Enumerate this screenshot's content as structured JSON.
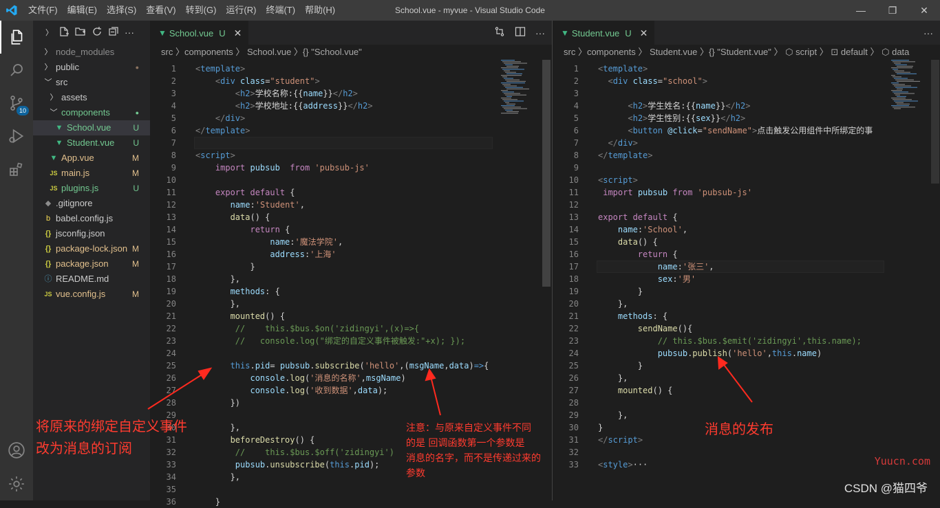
{
  "app": {
    "menu": [
      "文件(F)",
      "编辑(E)",
      "选择(S)",
      "查看(V)",
      "转到(G)",
      "运行(R)",
      "终端(T)",
      "帮助(H)"
    ],
    "window_title": "School.vue - myvue - Visual Studio Code",
    "window_controls": [
      "—",
      "❐",
      "✕"
    ]
  },
  "activity_bar": {
    "icons": [
      "files-icon",
      "search-icon",
      "source-control-icon",
      "run-debug-icon",
      "extensions-icon",
      "account-icon",
      "settings-gear-icon"
    ],
    "scm_badge": "10"
  },
  "explorer": {
    "items": [
      {
        "label": "node_modules",
        "indent": 1,
        "type": "folder-collapsed",
        "color": "#8c8c8c",
        "badge": ""
      },
      {
        "label": "public",
        "indent": 1,
        "type": "folder-collapsed",
        "color": "#cccccc",
        "badge": "●",
        "badge_color": "#8b7360"
      },
      {
        "label": "src",
        "indent": 1,
        "type": "folder-open",
        "color": "#cccccc",
        "badge": ""
      },
      {
        "label": "assets",
        "indent": 2,
        "type": "folder-collapsed",
        "color": "#cccccc",
        "badge": ""
      },
      {
        "label": "components",
        "indent": 2,
        "type": "folder-open",
        "color": "#73c991",
        "badge": "●",
        "badge_color": "#73c991"
      },
      {
        "label": "School.vue",
        "indent": 3,
        "type": "vue",
        "color": "#73c991",
        "badge": "U",
        "badge_color": "#73c991",
        "selected": true
      },
      {
        "label": "Student.vue",
        "indent": 3,
        "type": "vue",
        "color": "#73c991",
        "badge": "U",
        "badge_color": "#73c991"
      },
      {
        "label": "App.vue",
        "indent": 2,
        "type": "vue",
        "color": "#e2c08d",
        "badge": "M",
        "badge_color": "#e2c08d"
      },
      {
        "label": "main.js",
        "indent": 2,
        "type": "js",
        "color": "#e2c08d",
        "badge": "M",
        "badge_color": "#e2c08d"
      },
      {
        "label": "plugins.js",
        "indent": 2,
        "type": "js",
        "color": "#73c991",
        "badge": "U",
        "badge_color": "#73c991"
      },
      {
        "label": ".gitignore",
        "indent": 1,
        "type": "git",
        "color": "#cccccc",
        "badge": ""
      },
      {
        "label": "babel.config.js",
        "indent": 1,
        "type": "babel",
        "color": "#cccccc",
        "badge": ""
      },
      {
        "label": "jsconfig.json",
        "indent": 1,
        "type": "json",
        "color": "#cccccc",
        "badge": ""
      },
      {
        "label": "package-lock.json",
        "indent": 1,
        "type": "json",
        "color": "#e2c08d",
        "badge": "M",
        "badge_color": "#e2c08d"
      },
      {
        "label": "package.json",
        "indent": 1,
        "type": "json",
        "color": "#e2c08d",
        "badge": "M",
        "badge_color": "#e2c08d"
      },
      {
        "label": "README.md",
        "indent": 1,
        "type": "info",
        "color": "#cccccc",
        "badge": ""
      },
      {
        "label": "vue.config.js",
        "indent": 1,
        "type": "js",
        "color": "#e2c08d",
        "badge": "M",
        "badge_color": "#e2c08d"
      }
    ]
  },
  "left_editor": {
    "tab_label": "School.vue",
    "tab_status": "U",
    "breadcrumb": "src 〉components 〉 School.vue 〉{} \"School.vue\"",
    "start_line": 1,
    "lines": [
      [
        [
          "<",
          "t"
        ],
        [
          "template",
          "tg"
        ],
        [
          ">",
          "t"
        ]
      ],
      [
        [
          "    ",
          "pl"
        ],
        [
          "<",
          "t"
        ],
        [
          "div",
          "tg"
        ],
        [
          " class",
          "at"
        ],
        [
          "=",
          "pl"
        ],
        [
          "\"student\"",
          "st"
        ],
        [
          ">",
          "t"
        ]
      ],
      [
        [
          "        ",
          "pl"
        ],
        [
          "<",
          "t"
        ],
        [
          "h2",
          "tg"
        ],
        [
          ">",
          "t"
        ],
        [
          "学校名称:{{",
          "pl"
        ],
        [
          "name",
          "vr"
        ],
        [
          "}}",
          "pl"
        ],
        [
          "</",
          "t"
        ],
        [
          "h2",
          "tg"
        ],
        [
          ">",
          "t"
        ]
      ],
      [
        [
          "        ",
          "pl"
        ],
        [
          "<",
          "t"
        ],
        [
          "h2",
          "tg"
        ],
        [
          ">",
          "t"
        ],
        [
          "学校地址:{{",
          "pl"
        ],
        [
          "address",
          "vr"
        ],
        [
          "}}",
          "pl"
        ],
        [
          "</",
          "t"
        ],
        [
          "h2",
          "tg"
        ],
        [
          ">",
          "t"
        ]
      ],
      [
        [
          "    ",
          "pl"
        ],
        [
          "</",
          "t"
        ],
        [
          "div",
          "tg"
        ],
        [
          ">",
          "t"
        ]
      ],
      [
        [
          "</",
          "t"
        ],
        [
          "template",
          "tg"
        ],
        [
          ">",
          "t"
        ]
      ],
      [
        [
          "",
          "pl"
        ]
      ],
      [
        [
          "<",
          "t"
        ],
        [
          "script",
          "tg"
        ],
        [
          ">",
          "t"
        ]
      ],
      [
        [
          "    ",
          "pl"
        ],
        [
          "import ",
          "kw"
        ],
        [
          "pubsub  ",
          "vr"
        ],
        [
          "from ",
          "kw"
        ],
        [
          "'pubsub-js'",
          "st"
        ]
      ],
      [
        [
          "",
          "pl"
        ]
      ],
      [
        [
          "    ",
          "pl"
        ],
        [
          "export default ",
          "kw"
        ],
        [
          "{",
          "pl"
        ]
      ],
      [
        [
          "       ",
          "pl"
        ],
        [
          "name",
          "vr"
        ],
        [
          ":",
          "pl"
        ],
        [
          "'Student'",
          "st"
        ],
        [
          ",",
          "pl"
        ]
      ],
      [
        [
          "       ",
          "pl"
        ],
        [
          "data",
          "fn"
        ],
        [
          "() {",
          "pl"
        ]
      ],
      [
        [
          "           ",
          "pl"
        ],
        [
          "return ",
          "kw"
        ],
        [
          "{",
          "pl"
        ]
      ],
      [
        [
          "               ",
          "pl"
        ],
        [
          "name",
          "vr"
        ],
        [
          ":",
          "pl"
        ],
        [
          "'魔法学院'",
          "st"
        ],
        [
          ",",
          "pl"
        ]
      ],
      [
        [
          "               ",
          "pl"
        ],
        [
          "address",
          "vr"
        ],
        [
          ":",
          "pl"
        ],
        [
          "'上海'",
          "st"
        ]
      ],
      [
        [
          "           ",
          "pl"
        ],
        [
          "}",
          "pl"
        ]
      ],
      [
        [
          "       ",
          "pl"
        ],
        [
          "},",
          "pl"
        ]
      ],
      [
        [
          "       ",
          "pl"
        ],
        [
          "methods",
          "vr"
        ],
        [
          ": {",
          "pl"
        ]
      ],
      [
        [
          "       ",
          "pl"
        ],
        [
          "},",
          "pl"
        ]
      ],
      [
        [
          "       ",
          "pl"
        ],
        [
          "mounted",
          "fn"
        ],
        [
          "() {",
          "pl"
        ]
      ],
      [
        [
          "        ",
          "pl"
        ],
        [
          "//    this.$bus.$on('zidingyi',(x)=>{",
          "cm"
        ]
      ],
      [
        [
          "        ",
          "pl"
        ],
        [
          "//   console.log(\"绑定的自定义事件被触发:\"+x); });",
          "cm"
        ]
      ],
      [
        [
          "",
          "pl"
        ]
      ],
      [
        [
          "       ",
          "pl"
        ],
        [
          "this",
          "bl"
        ],
        [
          ".",
          "pl"
        ],
        [
          "pid",
          "vr"
        ],
        [
          "= ",
          "pl"
        ],
        [
          "pubsub",
          "vr"
        ],
        [
          ".",
          "pl"
        ],
        [
          "subscribe",
          "fn"
        ],
        [
          "(",
          "pl"
        ],
        [
          "'hello'",
          "st"
        ],
        [
          ",(",
          "pl"
        ],
        [
          "msgName",
          "vr"
        ],
        [
          ",",
          "pl"
        ],
        [
          "data",
          "vr"
        ],
        [
          ")",
          "pl"
        ],
        [
          "=>",
          "bl"
        ],
        [
          "{",
          "pl"
        ]
      ],
      [
        [
          "           ",
          "pl"
        ],
        [
          "console",
          "vr"
        ],
        [
          ".",
          "pl"
        ],
        [
          "log",
          "fn"
        ],
        [
          "(",
          "pl"
        ],
        [
          "'消息的名称'",
          "st"
        ],
        [
          ",",
          "pl"
        ],
        [
          "msgName",
          "vr"
        ],
        [
          ")",
          "pl"
        ]
      ],
      [
        [
          "           ",
          "pl"
        ],
        [
          "console",
          "vr"
        ],
        [
          ".",
          "pl"
        ],
        [
          "log",
          "fn"
        ],
        [
          "(",
          "pl"
        ],
        [
          "'收到数据'",
          "st"
        ],
        [
          ",",
          "pl"
        ],
        [
          "data",
          "vr"
        ],
        [
          ");",
          "pl"
        ]
      ],
      [
        [
          "       ",
          "pl"
        ],
        [
          "})",
          "pl"
        ]
      ],
      [
        [
          "",
          "pl"
        ]
      ],
      [
        [
          "       ",
          "pl"
        ],
        [
          "},",
          "pl"
        ]
      ],
      [
        [
          "       ",
          "pl"
        ],
        [
          "beforeDestroy",
          "fn"
        ],
        [
          "() {",
          "pl"
        ]
      ],
      [
        [
          "        ",
          "pl"
        ],
        [
          "//    this.$bus.$off('zidingyi')",
          "cm"
        ]
      ],
      [
        [
          "        ",
          "pl"
        ],
        [
          "pubsub",
          "vr"
        ],
        [
          ".",
          "pl"
        ],
        [
          "unsubscribe",
          "fn"
        ],
        [
          "(",
          "pl"
        ],
        [
          "this",
          "bl"
        ],
        [
          ".",
          "pl"
        ],
        [
          "pid",
          "vr"
        ],
        [
          ");",
          "pl"
        ]
      ],
      [
        [
          "       ",
          "pl"
        ],
        [
          "},",
          "pl"
        ]
      ],
      [
        [
          "",
          "pl"
        ]
      ],
      [
        [
          "    ",
          "pl"
        ],
        [
          "}",
          "pl"
        ]
      ]
    ]
  },
  "right_editor": {
    "tab_label": "Student.vue",
    "tab_status": "U",
    "breadcrumb": "src 〉components 〉 Student.vue 〉{} \"Student.vue\" 〉 ⬡ script 〉 ⊡ default 〉 ⬡ data",
    "start_line": 1,
    "lines": [
      [
        [
          "<",
          "t"
        ],
        [
          "template",
          "tg"
        ],
        [
          ">",
          "t"
        ]
      ],
      [
        [
          "  ",
          "pl"
        ],
        [
          "<",
          "t"
        ],
        [
          "div",
          "tg"
        ],
        [
          " class",
          "at"
        ],
        [
          "=",
          "pl"
        ],
        [
          "\"school\"",
          "st"
        ],
        [
          ">",
          "t"
        ]
      ],
      [
        [
          "",
          "pl"
        ]
      ],
      [
        [
          "      ",
          "pl"
        ],
        [
          "<",
          "t"
        ],
        [
          "h2",
          "tg"
        ],
        [
          ">",
          "t"
        ],
        [
          "学生姓名:{{",
          "pl"
        ],
        [
          "name",
          "vr"
        ],
        [
          "}}",
          "pl"
        ],
        [
          "</",
          "t"
        ],
        [
          "h2",
          "tg"
        ],
        [
          ">",
          "t"
        ]
      ],
      [
        [
          "      ",
          "pl"
        ],
        [
          "<",
          "t"
        ],
        [
          "h2",
          "tg"
        ],
        [
          ">",
          "t"
        ],
        [
          "学生性别:{{",
          "pl"
        ],
        [
          "sex",
          "vr"
        ],
        [
          "}}",
          "pl"
        ],
        [
          "</",
          "t"
        ],
        [
          "h2",
          "tg"
        ],
        [
          ">",
          "t"
        ]
      ],
      [
        [
          "      ",
          "pl"
        ],
        [
          "<",
          "t"
        ],
        [
          "button ",
          "tg"
        ],
        [
          "@click",
          "at"
        ],
        [
          "=",
          "pl"
        ],
        [
          "\"sendName\"",
          "st"
        ],
        [
          ">",
          "t"
        ],
        [
          "点击触发公用组件中所绑定的事",
          "pl"
        ]
      ],
      [
        [
          "  ",
          "pl"
        ],
        [
          "</",
          "t"
        ],
        [
          "div",
          "tg"
        ],
        [
          ">",
          "t"
        ]
      ],
      [
        [
          "</",
          "t"
        ],
        [
          "template",
          "tg"
        ],
        [
          ">",
          "t"
        ]
      ],
      [
        [
          "",
          "pl"
        ]
      ],
      [
        [
          "<",
          "t"
        ],
        [
          "script",
          "tg"
        ],
        [
          ">",
          "t"
        ]
      ],
      [
        [
          " ",
          "pl"
        ],
        [
          "import ",
          "kw"
        ],
        [
          "pubsub ",
          "vr"
        ],
        [
          "from ",
          "kw"
        ],
        [
          "'pubsub-js'",
          "st"
        ]
      ],
      [
        [
          "",
          "pl"
        ]
      ],
      [
        [
          "export default ",
          "kw"
        ],
        [
          "{",
          "pl"
        ]
      ],
      [
        [
          "    ",
          "pl"
        ],
        [
          "name",
          "vr"
        ],
        [
          ":",
          "pl"
        ],
        [
          "'School'",
          "st"
        ],
        [
          ",",
          "pl"
        ]
      ],
      [
        [
          "    ",
          "pl"
        ],
        [
          "data",
          "fn"
        ],
        [
          "() {",
          "pl"
        ]
      ],
      [
        [
          "        ",
          "pl"
        ],
        [
          "return ",
          "kw"
        ],
        [
          "{",
          "pl"
        ]
      ],
      [
        [
          "            ",
          "pl"
        ],
        [
          "name",
          "vr"
        ],
        [
          ":",
          "pl"
        ],
        [
          "'张三'",
          "st"
        ],
        [
          ",",
          "pl"
        ]
      ],
      [
        [
          "            ",
          "pl"
        ],
        [
          "sex",
          "vr"
        ],
        [
          ":",
          "pl"
        ],
        [
          "'男'",
          "st"
        ]
      ],
      [
        [
          "        ",
          "pl"
        ],
        [
          "}",
          "pl"
        ]
      ],
      [
        [
          "    ",
          "pl"
        ],
        [
          "},",
          "pl"
        ]
      ],
      [
        [
          "    ",
          "pl"
        ],
        [
          "methods",
          "vr"
        ],
        [
          ": {",
          "pl"
        ]
      ],
      [
        [
          "        ",
          "pl"
        ],
        [
          "sendName",
          "fn"
        ],
        [
          "(){",
          "pl"
        ]
      ],
      [
        [
          "            ",
          "pl"
        ],
        [
          "// this.$bus.$emit('zidingyi',this.name);",
          "cm"
        ]
      ],
      [
        [
          "            ",
          "pl"
        ],
        [
          "pubsub",
          "vr"
        ],
        [
          ".",
          "pl"
        ],
        [
          "publish",
          "fn"
        ],
        [
          "(",
          "pl"
        ],
        [
          "'hello'",
          "st"
        ],
        [
          ",",
          "pl"
        ],
        [
          "this",
          "bl"
        ],
        [
          ".",
          "pl"
        ],
        [
          "name",
          "vr"
        ],
        [
          ")",
          "pl"
        ]
      ],
      [
        [
          "        ",
          "pl"
        ],
        [
          "}",
          "pl"
        ]
      ],
      [
        [
          "    ",
          "pl"
        ],
        [
          "},",
          "pl"
        ]
      ],
      [
        [
          "    ",
          "pl"
        ],
        [
          "mounted",
          "fn"
        ],
        [
          "() {",
          "pl"
        ]
      ],
      [
        [
          "",
          "pl"
        ]
      ],
      [
        [
          "    ",
          "pl"
        ],
        [
          "},",
          "pl"
        ]
      ],
      [
        [
          "}",
          "pl"
        ]
      ],
      [
        [
          "</",
          "t"
        ],
        [
          "script",
          "tg"
        ],
        [
          ">",
          "t"
        ]
      ],
      [
        [
          "",
          "pl"
        ]
      ],
      [
        [
          "<",
          "t"
        ],
        [
          "style",
          "tg"
        ],
        [
          ">",
          "t"
        ],
        [
          "···",
          "pl"
        ]
      ]
    ]
  },
  "annotations": {
    "left_note": "将原来的绑定自定义事件\n改为消息的订阅",
    "middle_note": "注意：与原来自定义事件不同\n的是 回调函数第一个参数是\n消息的名字，而不是传递过来的\n参数",
    "right_note": "消息的发布"
  },
  "watermark": {
    "site": "Yuucn.com",
    "author": "CSDN @猫四爷"
  },
  "colors": {
    "annotation_red": "#ff3b2f",
    "modified": "#e2c08d",
    "untracked": "#73c991"
  }
}
